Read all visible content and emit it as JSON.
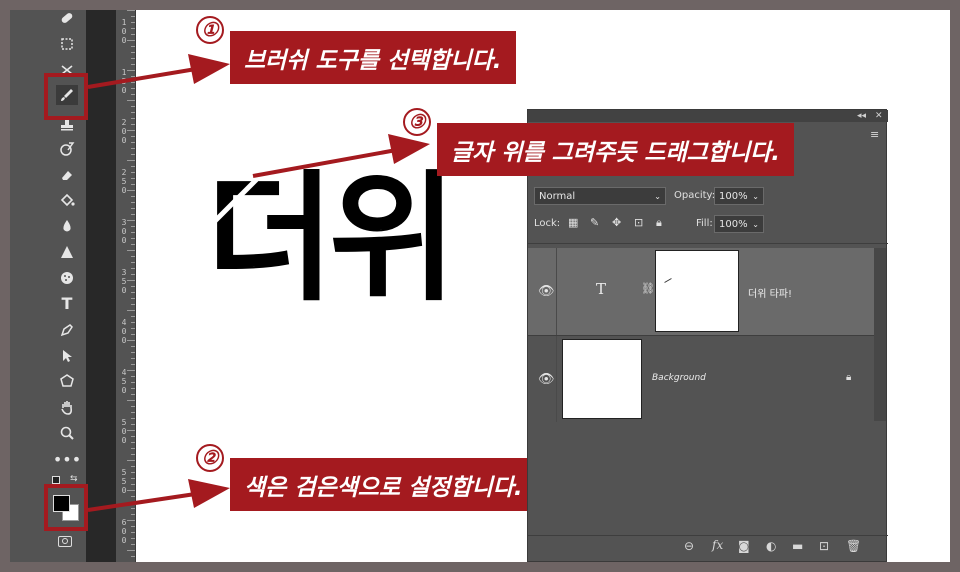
{
  "colors": {
    "accent": "#a41a1f",
    "toolbar": "#535353",
    "panel": "#535353",
    "selected_layer": "#6a6a6a",
    "canvas": "#ffffff"
  },
  "callouts": [
    {
      "number": "①",
      "text": "브러쉬 도구를 선택합니다."
    },
    {
      "number": "②",
      "text": "색은 검은색으로 설정합니다."
    },
    {
      "number": "③",
      "text": "글자 위를 그려주듯 드래그합니다."
    }
  ],
  "canvas_text": "더위",
  "ruler": {
    "labels": [
      "100",
      "150",
      "200",
      "250",
      "300",
      "350",
      "400",
      "450",
      "500",
      "550",
      "600"
    ]
  },
  "toolbar": {
    "icons": [
      "healing-brush-icon",
      "marquee-icon",
      "crop-icon",
      "brush-icon",
      "stamp-icon",
      "history-brush-icon",
      "eraser-icon",
      "bucket-icon",
      "blur-icon",
      "sharpen-icon",
      "sponge-icon",
      "type-icon",
      "pen-icon",
      "path-select-icon",
      "shape-icon",
      "hand-icon",
      "zoom-icon",
      "more-icon"
    ]
  },
  "layers_panel": {
    "blend_mode": "Normal",
    "opacity_label": "Opacity:",
    "opacity_value": "100%",
    "lock_label": "Lock:",
    "fill_label": "Fill:",
    "fill_value": "100%",
    "layers": [
      {
        "name": "더위 타파!",
        "type_glyph": "T",
        "selected": true
      },
      {
        "name": "Background",
        "selected": false
      }
    ]
  }
}
